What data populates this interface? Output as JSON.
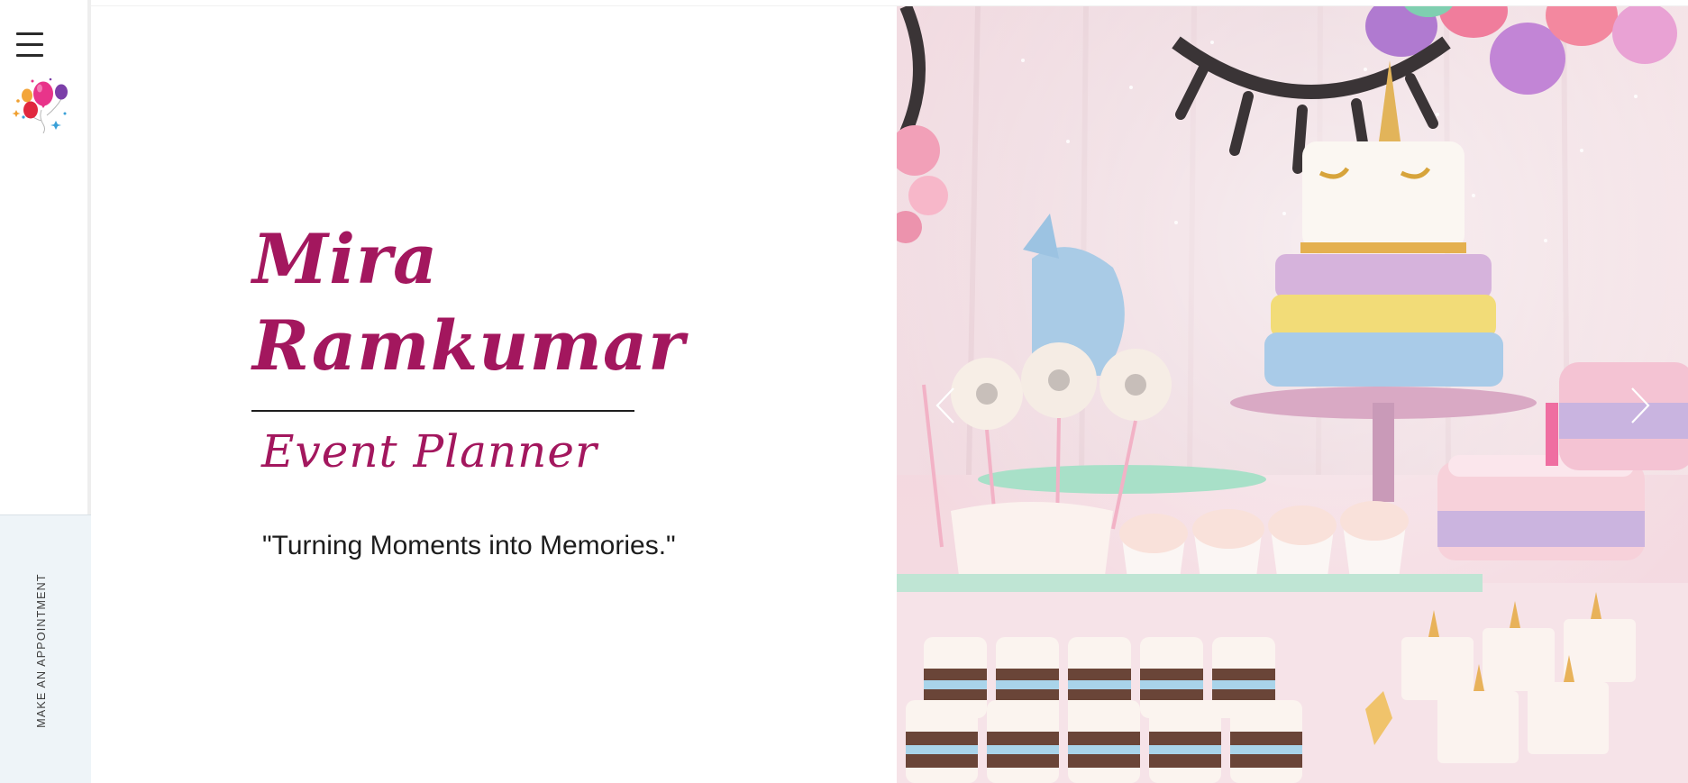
{
  "sidebar": {
    "menu_icon": "hamburger-menu-icon",
    "logo_icon": "balloons-logo-icon",
    "appointment_label": "MAKE AN APPOINTMENT"
  },
  "hero": {
    "name_line1": "Mira",
    "name_line2": "Ramkumar",
    "role": "Event Planner",
    "tagline": "\"Turning Moments into Memories.\""
  },
  "slideshow": {
    "prev_icon": "chevron-left-icon",
    "next_icon": "chevron-right-icon",
    "image_subject": "unicorn-themed dessert table"
  },
  "colors": {
    "accent": "#a3175e",
    "text": "#1d1d1d",
    "sidebar_panel": "#eef4f8"
  }
}
